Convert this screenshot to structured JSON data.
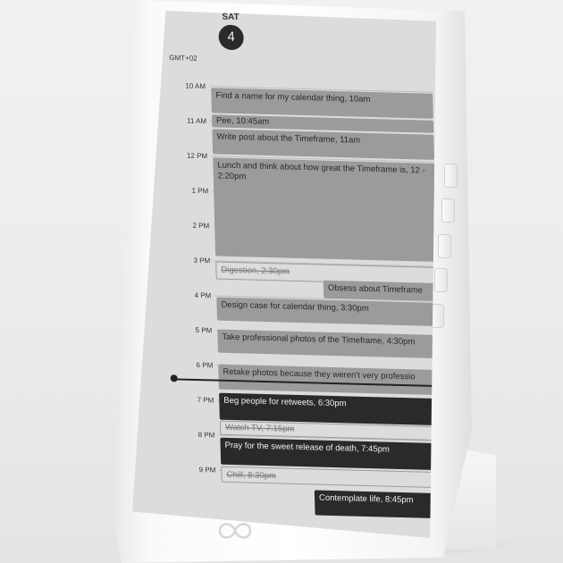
{
  "calendar": {
    "day_label": "SAT",
    "day_number": "4",
    "timezone": "GMT+02",
    "hours": [
      "10 AM",
      "11 AM",
      "12 PM",
      "1 PM",
      "2 PM",
      "3 PM",
      "4 PM",
      "5 PM",
      "6 PM",
      "7 PM",
      "8 PM",
      "9 PM"
    ],
    "events": [
      {
        "text": "Find a name for my calendar thing, 10am",
        "style": "grey"
      },
      {
        "text": "Pee, 10:45am",
        "style": "grey"
      },
      {
        "text": "Write post about the Timeframe, 11am",
        "style": "grey"
      },
      {
        "text": "Lunch and think about how great the Timeframe is, 12 - 2:20pm",
        "style": "grey"
      },
      {
        "text": "Digestion, 2:30pm",
        "style": "outline"
      },
      {
        "text": "Obsess about Timeframe",
        "style": "grey"
      },
      {
        "text": "Design case for calendar thing, 3:30pm",
        "style": "grey"
      },
      {
        "text": "Take professional photos of the Timeframe, 4:30pm",
        "style": "grey"
      },
      {
        "text": "Retake photos because they weren't very professio",
        "style": "grey"
      },
      {
        "text": "Beg people for retweets, 6:30pm",
        "style": "dark"
      },
      {
        "text": "Watch TV, 7:15pm",
        "style": "outline"
      },
      {
        "text": "Pray for the sweet release of death, 7:45pm",
        "style": "dark"
      },
      {
        "text": "Chill, 8:30pm",
        "style": "outline"
      },
      {
        "text": "Contemplate life, 8:45pm",
        "style": "dark"
      }
    ]
  },
  "colors": {
    "screen": "#dcdcdc",
    "event_grey": "#9b9b9b",
    "event_dark": "#2a2a2a",
    "device_body": "#ffffff"
  }
}
